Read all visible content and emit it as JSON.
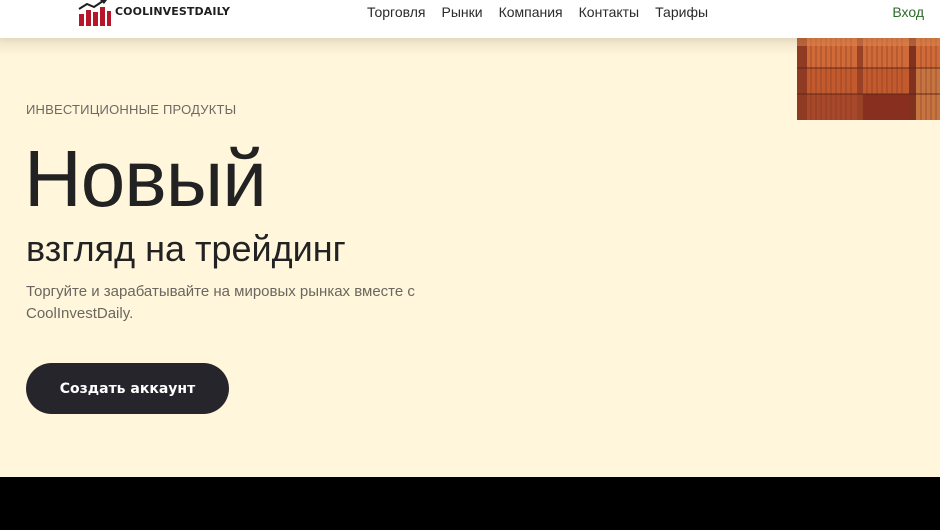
{
  "header": {
    "logo_text": "COOLINVESTDAILY",
    "nav": [
      {
        "label": "Торговля"
      },
      {
        "label": "Рынки"
      },
      {
        "label": "Компания"
      },
      {
        "label": "Контакты"
      },
      {
        "label": "Тарифы"
      }
    ],
    "login_label": "Вход"
  },
  "hero": {
    "eyebrow": "ИНВЕСТИЦИОННЫЕ ПРОДУКТЫ",
    "title": "Новый",
    "subtitle": "взгляд на трейдинг",
    "description": "Торгуйте и зарабатывайте на мировых рынках вместе с CoolInvestDaily.",
    "cta_label": "Создать аккаунт",
    "image_subject": "shipping-containers-photo"
  },
  "colors": {
    "hero_background": "#fff6dc",
    "cta_background": "#27252c",
    "login_link": "#2e6b2b",
    "logo_accent": "#b5162a",
    "footer_band": "#000000"
  }
}
